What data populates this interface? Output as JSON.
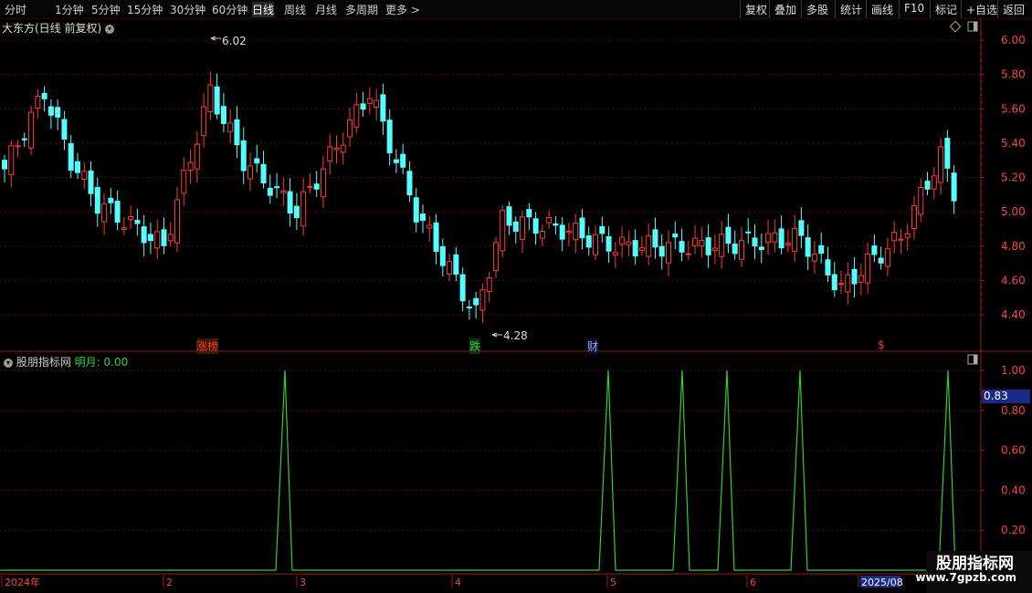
{
  "toolbar": {
    "left_items": [
      "分时",
      "1分钟",
      "5分钟",
      "15分钟",
      "30分钟",
      "60分钟",
      "日线",
      "周线",
      "月线",
      "多周期",
      "更多 >"
    ],
    "active_index": 6,
    "right_items": [
      "复权",
      "叠加",
      "多股",
      "统计",
      "画线",
      "F10",
      "标记",
      "+自选",
      "返回"
    ]
  },
  "chart": {
    "stock_title": "大东方(日线 前复权)",
    "high_label": "6.02",
    "low_label": "4.28",
    "markers": [
      {
        "text": "涨榜",
        "color": "#ff3030",
        "bg": "#3a1a00"
      },
      {
        "text": "跌",
        "color": "#30d030",
        "bg": "#103010"
      },
      {
        "text": "财",
        "color": "#a0a0ff",
        "bg": "#10102a"
      },
      {
        "text": "$",
        "color": "#ff3030",
        "bg": "#000000"
      }
    ],
    "y_ticks": [
      "6.00",
      "5.80",
      "5.60",
      "5.40",
      "5.20",
      "5.00",
      "4.80",
      "4.60",
      "4.40"
    ]
  },
  "indicator": {
    "name": "股朋指标网",
    "series_label": "明月:",
    "series_value": "0.00",
    "y_ticks": [
      "1.00",
      "0.80",
      "0.60",
      "0.40",
      "0.20"
    ],
    "cursor_value": "0.83"
  },
  "xaxis": {
    "labels": [
      "2024年",
      "2",
      "3",
      "4",
      "5",
      "6",
      "2025/08"
    ]
  },
  "watermark": {
    "title": "股朋指标网",
    "url": "www.7gpzb.com"
  }
}
